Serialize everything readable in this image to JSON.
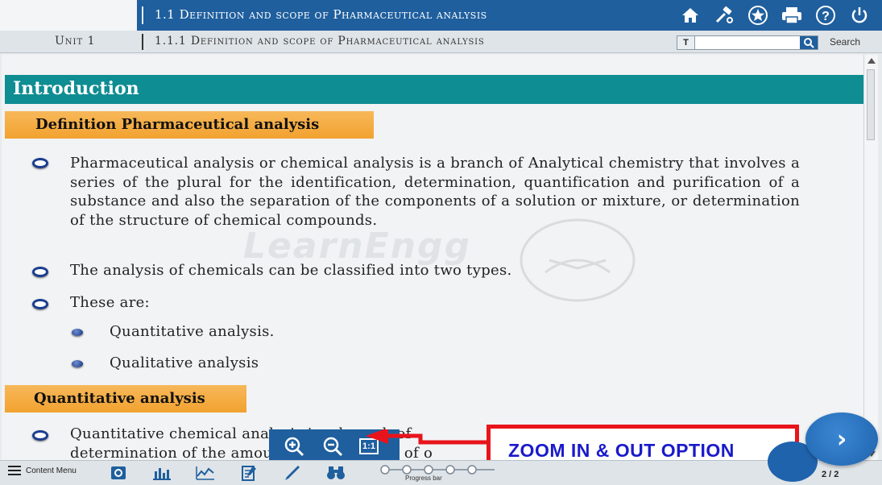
{
  "header": {
    "title": "1.1 Definition and scope of Pharmaceutical analysis",
    "icons": [
      "home-icon",
      "tools-icon",
      "star-icon",
      "print-icon",
      "help-icon",
      "power-icon"
    ]
  },
  "subheader": {
    "unit": "Unit 1",
    "subtitle": "1.1.1 Definition and scope of Pharmaceutical analysis",
    "search_prefix": "T",
    "search_value": "",
    "search_label": "Search"
  },
  "content": {
    "intro": "Introduction",
    "heading1": "Definition Pharmaceutical analysis",
    "para1": "Pharmaceutical analysis or chemical analysis is a branch of Analytical chemistry that involves a series of the plural for the identification, determination, quantification and purification of a substance and also the separation of the components of a solution or mixture, or determination of the structure of chemical compounds.",
    "para2": "The analysis of chemicals can be classified into two types.",
    "para3": "These are:",
    "sub1": "Quantitative analysis.",
    "sub2": "Qualitative analysis",
    "heading2": "Quantitative analysis",
    "para4_line1": "Quantitative   chemical   analysis   is   a branch   of",
    "para4_line2": "determination of the amount or percentage of o",
    "watermark": "LearnEngg"
  },
  "zoom": {
    "one_to_one": "1:1"
  },
  "annotation": {
    "text": "ZOOM IN & OUT OPTION"
  },
  "footer": {
    "content_menu": "Content Menu",
    "progress_label": "Progress bar",
    "page": "2 / 2",
    "next": "›"
  },
  "colors": {
    "header_blue": "#1f5f9e",
    "teal": "#0e8d92",
    "orange": "#f2a22f",
    "annotation_red": "#e8141c",
    "annotation_text": "#1a1acb"
  }
}
